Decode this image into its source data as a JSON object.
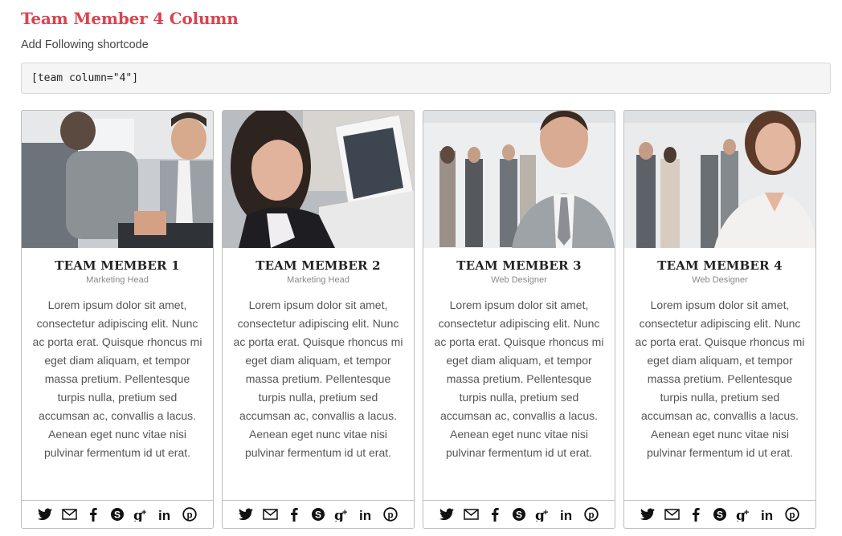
{
  "page": {
    "title": "Team Member 4 Column",
    "intro": "Add Following shortcode",
    "shortcode": "[team column=\"4\"]"
  },
  "members": [
    {
      "name": "TEAM MEMBER 1",
      "role": "Marketing Head",
      "bio": "Lorem ipsum dolor sit amet, consectetur adipiscing elit. Nunc ac porta erat. Quisque rhoncus mi eget diam aliquam, et tempor massa pretium. Pellentesque turpis nulla, pretium sed accumsan ac, convallis a lacus. Aenean eget nunc vitae nisi pulvinar fermentum id ut erat.",
      "photo": "office-meeting-man"
    },
    {
      "name": "TEAM MEMBER 2",
      "role": "Marketing Head",
      "bio": "Lorem ipsum dolor sit amet, consectetur adipiscing elit. Nunc ac porta erat. Quisque rhoncus mi eget diam aliquam, et tempor massa pretium. Pellentesque turpis nulla, pretium sed accumsan ac, convallis a lacus. Aenean eget nunc vitae nisi pulvinar fermentum id ut erat.",
      "photo": "woman-laptop"
    },
    {
      "name": "TEAM MEMBER 3",
      "role": "Web Designer",
      "bio": "Lorem ipsum dolor sit amet, consectetur adipiscing elit. Nunc ac porta erat. Quisque rhoncus mi eget diam aliquam, et tempor massa pretium. Pellentesque turpis nulla, pretium sed accumsan ac, convallis a lacus. Aenean eget nunc vitae nisi pulvinar fermentum id ut erat.",
      "photo": "smiling-man-office"
    },
    {
      "name": "TEAM MEMBER 4",
      "role": "Web Designer",
      "bio": "Lorem ipsum dolor sit amet, consectetur adipiscing elit. Nunc ac porta erat. Quisque rhoncus mi eget diam aliquam, et tempor massa pretium. Pellentesque turpis nulla, pretium sed accumsan ac, convallis a lacus. Aenean eget nunc vitae nisi pulvinar fermentum id ut erat.",
      "photo": "smiling-woman-office"
    }
  ],
  "social_icons": [
    "twitter-icon",
    "email-icon",
    "facebook-icon",
    "skype-icon",
    "google-plus-icon",
    "linkedin-icon",
    "pinterest-icon"
  ],
  "colors": {
    "title": "#d9434f",
    "card_border": "#bdbdbd",
    "code_bg": "#f5f5f5"
  }
}
